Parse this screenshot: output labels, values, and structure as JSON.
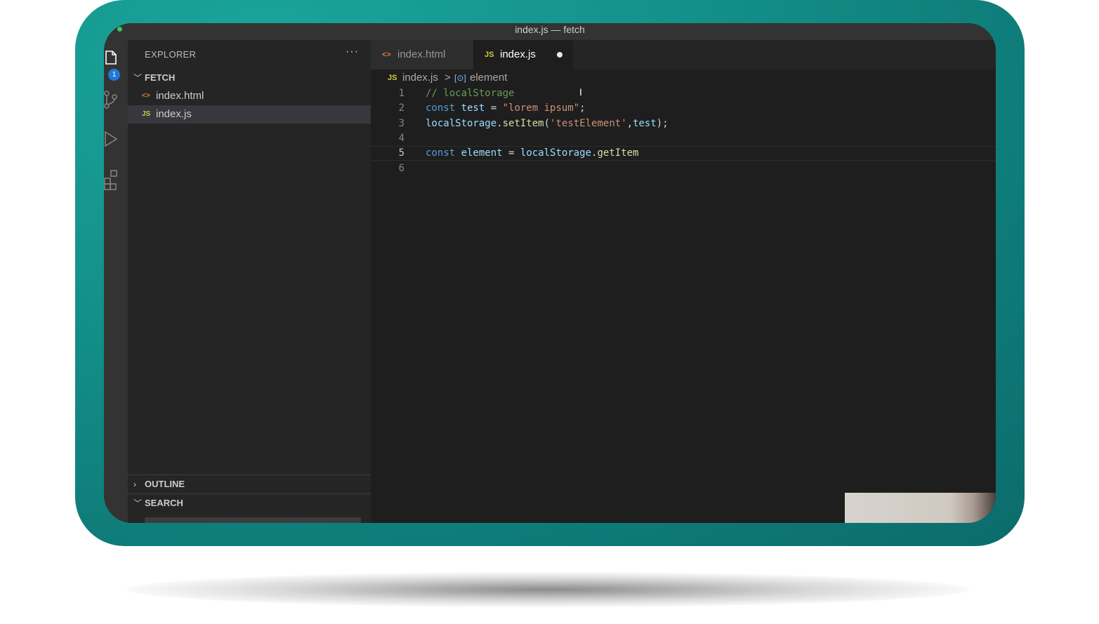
{
  "window": {
    "title": "index.js — fetch"
  },
  "activity_bar": {
    "explorer_badge": "1"
  },
  "sidebar": {
    "header": "EXPLORER",
    "more": "···",
    "folder": "FETCH",
    "files": [
      {
        "icon": "<>",
        "name": "index.html"
      },
      {
        "icon": "JS",
        "name": "index.js"
      }
    ],
    "outline": "OUTLINE",
    "search": "SEARCH"
  },
  "tabs": [
    {
      "icon": "<>",
      "label": "index.html"
    },
    {
      "icon": "JS",
      "label": "index.js"
    }
  ],
  "breadcrumb": {
    "file_icon": "JS",
    "file": "index.js",
    "separator": ">",
    "symbol_icon": "[⊙]",
    "symbol": "element"
  },
  "code": {
    "line_numbers": [
      "1",
      "2",
      "3",
      "4",
      "5",
      "6"
    ],
    "active_line": 5,
    "lines": [
      [
        {
          "t": "comment",
          "v": "// localStorage"
        }
      ],
      [
        {
          "t": "kw",
          "v": "const "
        },
        {
          "t": "var",
          "v": "test"
        },
        {
          "t": "plain",
          "v": " = "
        },
        {
          "t": "str",
          "v": "\"lorem ipsum\""
        },
        {
          "t": "plain",
          "v": ";"
        }
      ],
      [
        {
          "t": "var",
          "v": "localStorage"
        },
        {
          "t": "plain",
          "v": "."
        },
        {
          "t": "fn",
          "v": "setItem"
        },
        {
          "t": "plain",
          "v": "("
        },
        {
          "t": "str",
          "v": "'testElement'"
        },
        {
          "t": "plain",
          "v": ","
        },
        {
          "t": "var",
          "v": "test"
        },
        {
          "t": "plain",
          "v": ");"
        }
      ],
      [],
      [
        {
          "t": "kw",
          "v": "const "
        },
        {
          "t": "var",
          "v": "element"
        },
        {
          "t": "plain",
          "v": " = "
        },
        {
          "t": "var",
          "v": "localStorage"
        },
        {
          "t": "plain",
          "v": "."
        },
        {
          "t": "fn",
          "v": "getItem"
        }
      ],
      []
    ]
  },
  "colors": {
    "background_accent": "#139089",
    "editor_bg": "#1e1e1e",
    "sidebar_bg": "#252526",
    "keyword": "#569cd6",
    "string": "#ce9178",
    "comment": "#6a9955",
    "variable": "#9cdcfe",
    "function": "#dcdcaa"
  }
}
